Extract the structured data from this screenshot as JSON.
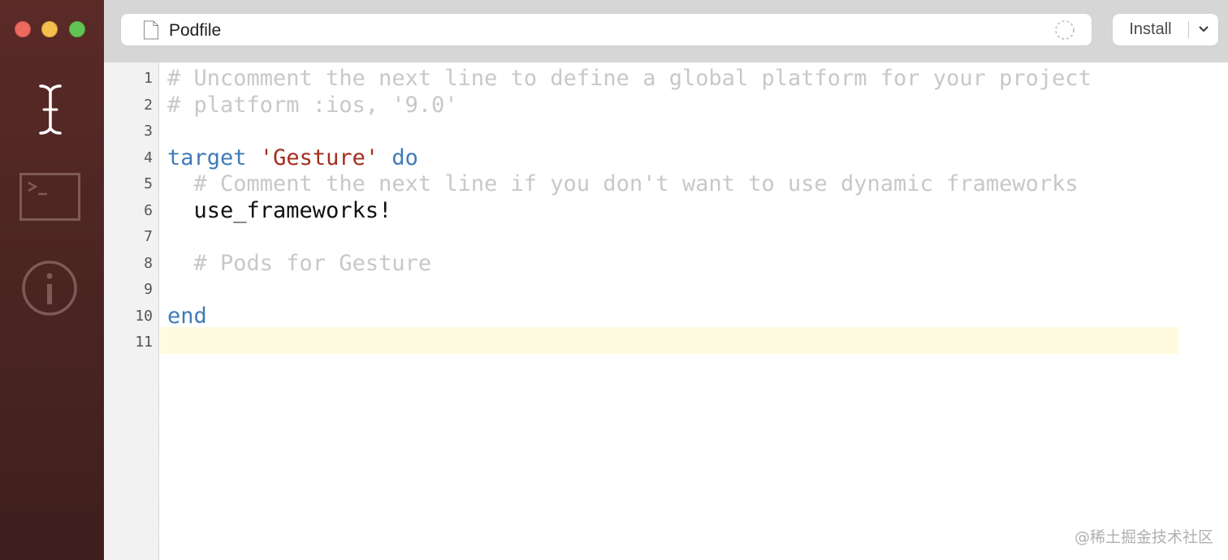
{
  "window": {
    "controls": [
      "close",
      "minimize",
      "maximize"
    ]
  },
  "sidebar": {
    "items": [
      {
        "icon": "text-cursor-icon"
      },
      {
        "icon": "terminal-icon",
        "glyph": ">_"
      },
      {
        "icon": "info-icon"
      }
    ]
  },
  "toolbar": {
    "file_name": "Podfile",
    "install_label": "Install"
  },
  "editor": {
    "line_numbers": [
      "1",
      "2",
      "3",
      "4",
      "5",
      "6",
      "7",
      "8",
      "9",
      "10",
      "11"
    ],
    "lines": [
      {
        "tokens": [
          {
            "type": "comment",
            "text": "# Uncomment the next line to define a global platform for your project"
          }
        ]
      },
      {
        "tokens": [
          {
            "type": "comment",
            "text": "# platform :ios, '9.0'"
          }
        ]
      },
      {
        "tokens": []
      },
      {
        "tokens": [
          {
            "type": "keyword",
            "text": "target"
          },
          {
            "type": "plain",
            "text": " "
          },
          {
            "type": "string",
            "text": "'Gesture'"
          },
          {
            "type": "plain",
            "text": " "
          },
          {
            "type": "keyword",
            "text": "do"
          }
        ]
      },
      {
        "tokens": [
          {
            "type": "plain",
            "text": "  "
          },
          {
            "type": "comment",
            "text": "# Comment the next line if you don't want to use dynamic frameworks"
          }
        ]
      },
      {
        "tokens": [
          {
            "type": "plain",
            "text": "  use_frameworks!"
          }
        ]
      },
      {
        "tokens": []
      },
      {
        "tokens": [
          {
            "type": "plain",
            "text": "  "
          },
          {
            "type": "comment",
            "text": "# Pods for Gesture"
          }
        ]
      },
      {
        "tokens": []
      },
      {
        "tokens": [
          {
            "type": "keyword",
            "text": "end"
          }
        ]
      },
      {
        "tokens": []
      }
    ],
    "current_line": 11
  },
  "watermark": "@稀土掘金技术社区",
  "colors": {
    "comment": "#c8c8c8",
    "keyword": "#3f7bb8",
    "string": "#a42d1e",
    "sidebar": "#4a2422",
    "current_line_highlight": "#fffbe0"
  }
}
